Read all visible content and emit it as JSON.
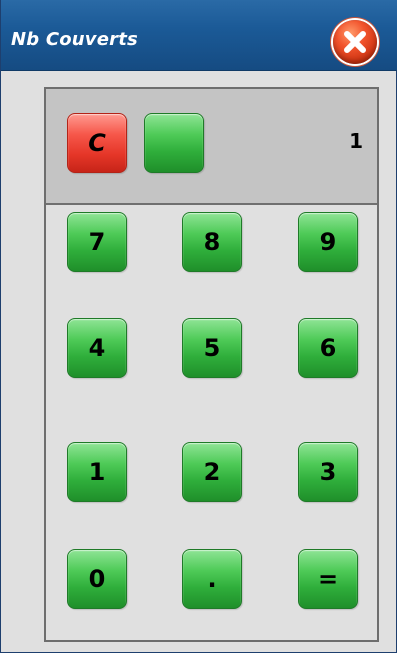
{
  "window": {
    "title": "Nb Couverts",
    "close_icon": "close-icon"
  },
  "display": {
    "value": "1",
    "clear_label": "C",
    "blank_label": ""
  },
  "keypad": {
    "keys": [
      "7",
      "8",
      "9",
      "4",
      "5",
      "6",
      "1",
      "2",
      "3",
      "0",
      ".",
      "="
    ]
  },
  "colors": {
    "titlebar": "#1b5a97",
    "button_green": "#2fae3b",
    "button_red": "#e53628",
    "panel_background": "#e0e0e0",
    "display_background": "#c4c4c4"
  }
}
